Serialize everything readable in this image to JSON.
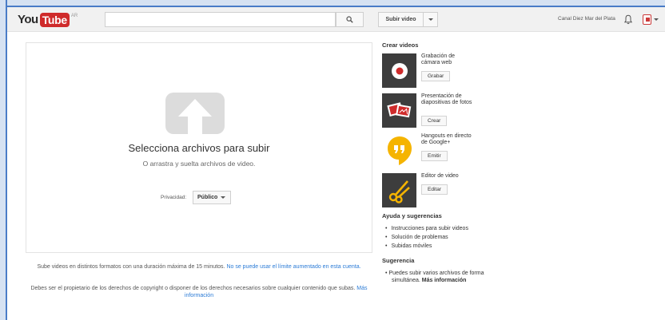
{
  "masthead": {
    "logo_you": "You",
    "logo_tube": "Tube",
    "logo_country": "AR",
    "search_placeholder": "",
    "upload_label": "Subir video",
    "channel_name": "Canal Diez Mar del Plata",
    "icons": [
      "search-icon",
      "bell-icon",
      "avatar-icon",
      "chevron-down-icon"
    ]
  },
  "upload": {
    "title": "Selecciona archivos para subir",
    "drag_text": "O arrastra y suelta archivos de video.",
    "privacy_label": "Privacidad:",
    "privacy_value": "Público"
  },
  "footnotes": {
    "line1_text": "Sube videos en distintos formatos con una duración máxima de 15 minutos.",
    "line1_link": "No se puede usar el límite aumentado en esta cuenta.",
    "line2_text": "Debes ser el propietario de los derechos de copyright o disponer de los derechos necesarios sobre cualquier contenido que subas.",
    "line2_link": "Más información"
  },
  "create": {
    "heading": "Crear videos",
    "items": [
      {
        "label": "Grabación de cámara web",
        "button": "Grabar",
        "icon": "record-icon"
      },
      {
        "label": "Presentación de diapositivas de fotos",
        "button": "Crear",
        "icon": "photos-icon"
      },
      {
        "label": "Hangouts en directo de Google+",
        "button": "Emitir",
        "icon": "hangouts-icon"
      },
      {
        "label": "Editor de video",
        "button": "Editar",
        "icon": "scissors-icon"
      }
    ]
  },
  "help": {
    "heading": "Ayuda y sugerencias",
    "items": [
      "Instrucciones para subir videos",
      "Solución de problemas",
      "Subidas móviles"
    ]
  },
  "tip": {
    "heading": "Sugerencia",
    "text": "Puedes subir varios archivos de forma simultánea.",
    "link": "Más información"
  },
  "colors": {
    "brand_red": "#cf2b2b",
    "link_blue": "#2b7bd6",
    "frame_blue": "#4a7cc7",
    "hangouts_yellow": "#f5b400",
    "thumb_dark": "#3d3d3d"
  }
}
